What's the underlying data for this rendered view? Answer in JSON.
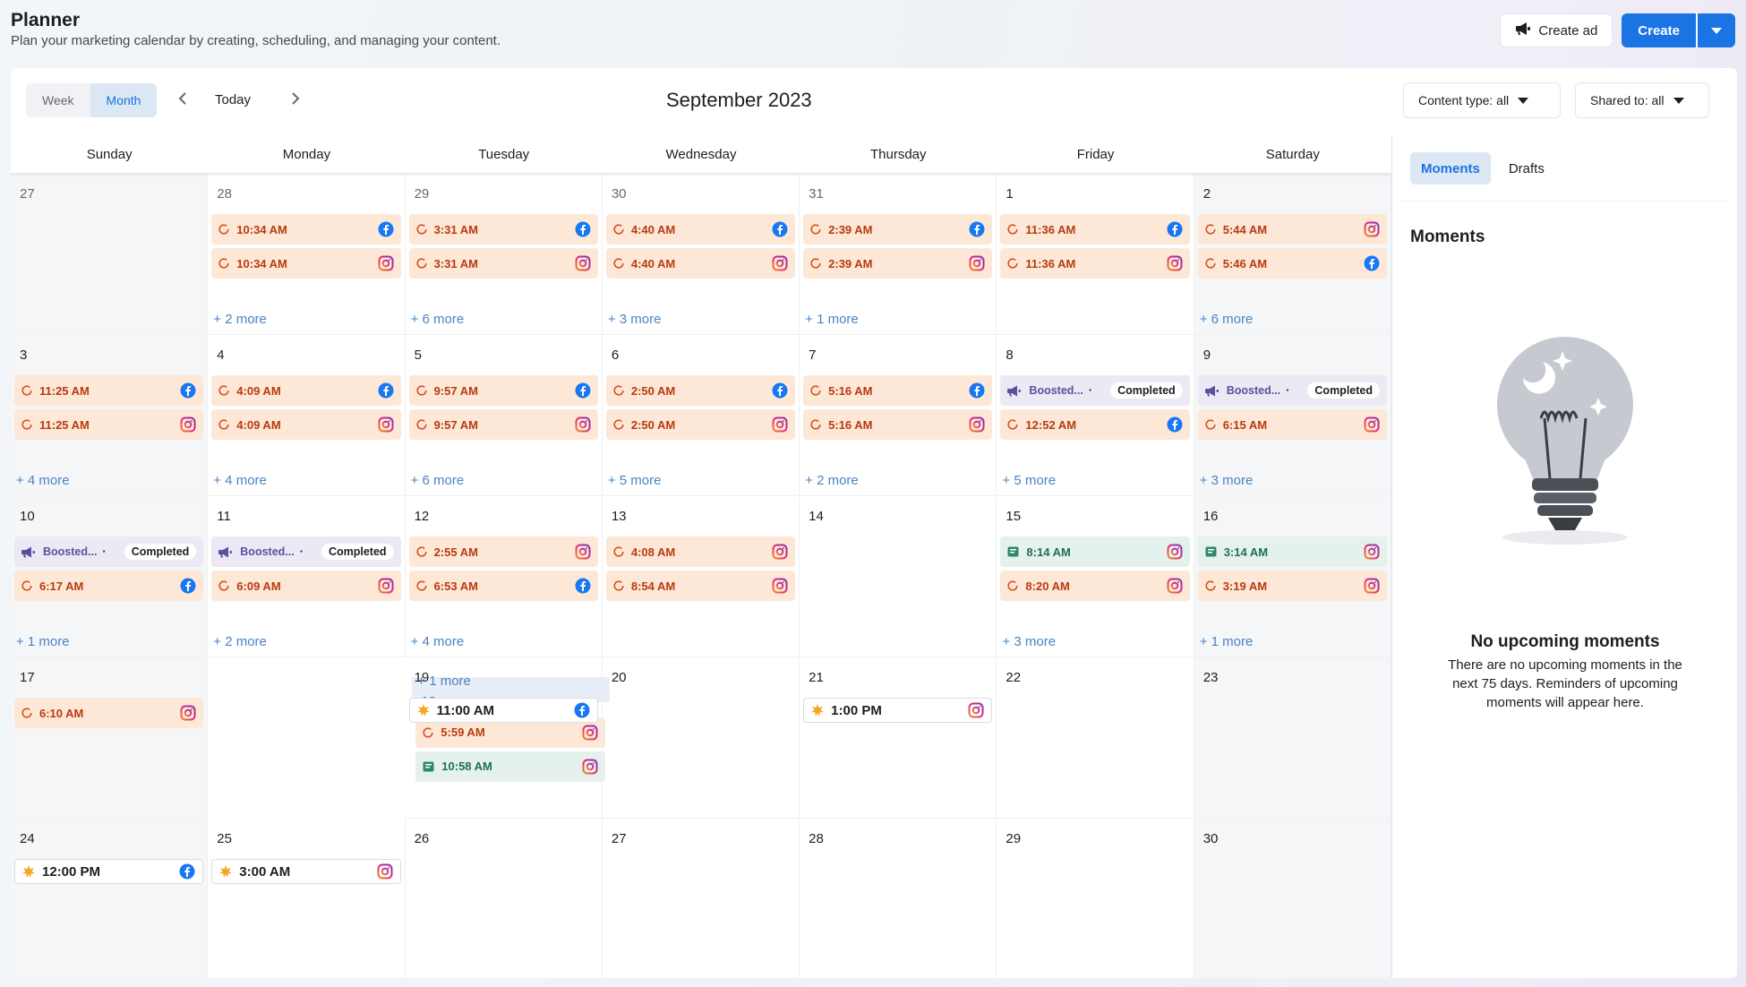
{
  "header": {
    "title": "Planner",
    "subtitle": "Plan your marketing calendar by creating, scheduling, and managing your content.",
    "create_ad": "Create ad",
    "create": "Create"
  },
  "toolbar": {
    "week": "Week",
    "month": "Month",
    "today": "Today",
    "month_title": "September 2023",
    "content_type": "Content type: all",
    "shared_to": "Shared to: all"
  },
  "days": [
    "Sunday",
    "Monday",
    "Tuesday",
    "Wednesday",
    "Thursday",
    "Friday",
    "Saturday"
  ],
  "weeks": [
    [
      {
        "day": "27",
        "muted": true,
        "weekend": true,
        "events": [],
        "more": ""
      },
      {
        "day": "28",
        "muted": true,
        "events": [
          {
            "type": "sched",
            "label": "10:34 AM",
            "net": "fb"
          },
          {
            "type": "sched",
            "label": "10:34 AM",
            "net": "ig"
          }
        ],
        "more": "+ 2 more"
      },
      {
        "day": "29",
        "muted": true,
        "events": [
          {
            "type": "sched",
            "label": "3:31 AM",
            "net": "fb"
          },
          {
            "type": "sched",
            "label": "3:31 AM",
            "net": "ig"
          }
        ],
        "more": "+ 6 more"
      },
      {
        "day": "30",
        "muted": true,
        "events": [
          {
            "type": "sched",
            "label": "4:40 AM",
            "net": "fb"
          },
          {
            "type": "sched",
            "label": "4:40 AM",
            "net": "ig"
          }
        ],
        "more": "+ 3 more"
      },
      {
        "day": "31",
        "muted": true,
        "events": [
          {
            "type": "sched",
            "label": "2:39 AM",
            "net": "fb"
          },
          {
            "type": "sched",
            "label": "2:39 AM",
            "net": "ig"
          }
        ],
        "more": "+ 1 more"
      },
      {
        "day": "1",
        "events": [
          {
            "type": "sched",
            "label": "11:36 AM",
            "net": "fb"
          },
          {
            "type": "sched",
            "label": "11:36 AM",
            "net": "ig"
          }
        ],
        "more": ""
      },
      {
        "day": "2",
        "weekend": true,
        "events": [
          {
            "type": "sched",
            "label": "5:44 AM",
            "net": "ig"
          },
          {
            "type": "sched",
            "label": "5:46 AM",
            "net": "fb"
          }
        ],
        "more": "+ 6 more"
      }
    ],
    [
      {
        "day": "3",
        "weekend": true,
        "events": [
          {
            "type": "sched",
            "label": "11:25 AM",
            "net": "fb"
          },
          {
            "type": "sched",
            "label": "11:25 AM",
            "net": "ig"
          }
        ],
        "more": "+ 4 more"
      },
      {
        "day": "4",
        "events": [
          {
            "type": "sched",
            "label": "4:09 AM",
            "net": "fb"
          },
          {
            "type": "sched",
            "label": "4:09 AM",
            "net": "ig"
          }
        ],
        "more": "+ 4 more"
      },
      {
        "day": "5",
        "events": [
          {
            "type": "sched",
            "label": "9:57 AM",
            "net": "fb"
          },
          {
            "type": "sched",
            "label": "9:57 AM",
            "net": "ig"
          }
        ],
        "more": "+ 6 more"
      },
      {
        "day": "6",
        "events": [
          {
            "type": "sched",
            "label": "2:50 AM",
            "net": "fb"
          },
          {
            "type": "sched",
            "label": "2:50 AM",
            "net": "ig"
          }
        ],
        "more": "+ 5 more"
      },
      {
        "day": "7",
        "events": [
          {
            "type": "sched",
            "label": "5:16 AM",
            "net": "fb"
          },
          {
            "type": "sched",
            "label": "5:16 AM",
            "net": "ig"
          }
        ],
        "more": "+ 2 more"
      },
      {
        "day": "8",
        "events": [
          {
            "type": "boost",
            "label": "Boosted...",
            "status": "Completed"
          },
          {
            "type": "sched",
            "label": "12:52 AM",
            "net": "fb"
          }
        ],
        "more": "+ 5 more"
      },
      {
        "day": "9",
        "weekend": true,
        "events": [
          {
            "type": "boost",
            "label": "Boosted...",
            "status": "Completed"
          },
          {
            "type": "sched",
            "label": "6:15 AM",
            "net": "ig"
          }
        ],
        "more": "+ 3 more"
      }
    ],
    [
      {
        "day": "10",
        "weekend": true,
        "events": [
          {
            "type": "boost",
            "label": "Boosted...",
            "status": "Completed"
          },
          {
            "type": "sched",
            "label": "6:17 AM",
            "net": "fb"
          }
        ],
        "more": "+ 1 more"
      },
      {
        "day": "11",
        "events": [
          {
            "type": "boost",
            "label": "Boosted...",
            "status": "Completed"
          },
          {
            "type": "sched",
            "label": "6:09 AM",
            "net": "ig"
          }
        ],
        "more": "+ 2 more"
      },
      {
        "day": "12",
        "events": [
          {
            "type": "sched",
            "label": "2:55 AM",
            "net": "ig"
          },
          {
            "type": "sched",
            "label": "6:53 AM",
            "net": "fb"
          }
        ],
        "more": "+ 4 more"
      },
      {
        "day": "13",
        "events": [
          {
            "type": "sched",
            "label": "4:08 AM",
            "net": "ig"
          },
          {
            "type": "sched",
            "label": "8:54 AM",
            "net": "ig"
          }
        ],
        "more": ""
      },
      {
        "day": "14",
        "events": [],
        "more": ""
      },
      {
        "day": "15",
        "events": [
          {
            "type": "pub",
            "label": "8:14 AM",
            "net": "ig"
          },
          {
            "type": "sched",
            "label": "8:20 AM",
            "net": "ig"
          }
        ],
        "more": "+ 3 more"
      },
      {
        "day": "16",
        "weekend": true,
        "events": [
          {
            "type": "pub",
            "label": "3:14 AM",
            "net": "ig"
          },
          {
            "type": "sched",
            "label": "3:19 AM",
            "net": "ig"
          }
        ],
        "more": "+ 1 more"
      }
    ],
    [
      {
        "day": "17",
        "weekend": true,
        "events": [
          {
            "type": "sched",
            "label": "6:10 AM",
            "net": "ig"
          }
        ],
        "more": ""
      },
      {
        "day": "18",
        "today": true,
        "events": [
          {
            "type": "sched",
            "label": "5:59 AM",
            "net": "ig"
          },
          {
            "type": "pub",
            "label": "10:58 AM",
            "net": "ig"
          }
        ],
        "more": "+ 1 more"
      },
      {
        "day": "19",
        "events": [
          {
            "type": "moment",
            "label": "11:00 AM",
            "net": "fb"
          }
        ],
        "more": ""
      },
      {
        "day": "20",
        "events": [],
        "more": ""
      },
      {
        "day": "21",
        "events": [
          {
            "type": "moment",
            "label": "1:00 PM",
            "net": "ig"
          }
        ],
        "more": ""
      },
      {
        "day": "22",
        "events": [],
        "more": ""
      },
      {
        "day": "23",
        "weekend": true,
        "events": [],
        "more": ""
      }
    ],
    [
      {
        "day": "24",
        "weekend": true,
        "events": [
          {
            "type": "moment",
            "label": "12:00 PM",
            "net": "fb"
          }
        ],
        "more": ""
      },
      {
        "day": "25",
        "events": [
          {
            "type": "moment",
            "label": "3:00 AM",
            "net": "ig"
          }
        ],
        "more": ""
      },
      {
        "day": "26",
        "events": [],
        "more": ""
      },
      {
        "day": "27",
        "events": [],
        "more": ""
      },
      {
        "day": "28",
        "events": [],
        "more": ""
      },
      {
        "day": "29",
        "events": [],
        "more": ""
      },
      {
        "day": "30",
        "weekend": true,
        "events": [],
        "more": ""
      }
    ]
  ],
  "side": {
    "tab_moments": "Moments",
    "tab_drafts": "Drafts",
    "heading": "Moments",
    "empty_title": "No upcoming moments",
    "empty_desc": "There are no upcoming moments in the next 75 days. Reminders of upcoming moments will appear here."
  },
  "colors": {
    "accent": "#1b74e4",
    "scheduled_bg": "#fde8d7",
    "scheduled_text": "#b83a0e",
    "published_bg": "#e4f1ec",
    "boosted_bg": "#ece9f5",
    "facebook": "#1877f2",
    "instagram": "#d6249f"
  }
}
